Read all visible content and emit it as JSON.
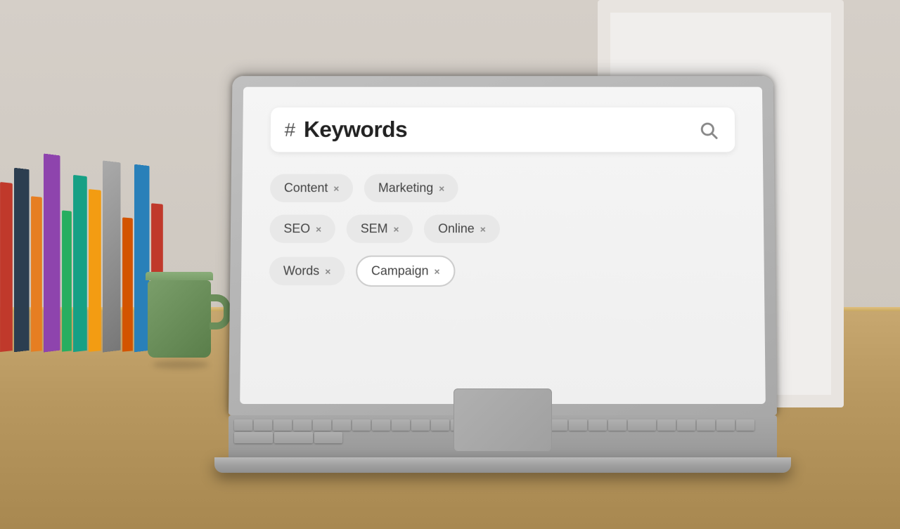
{
  "scene": {
    "background_color": "#c8b8a8"
  },
  "laptop": {
    "screen": {
      "background": "#f0f0f0",
      "search_bar": {
        "hash_symbol": "#",
        "placeholder": "Keywords",
        "search_icon": "🔍"
      },
      "tags": [
        [
          {
            "label": "Content",
            "close": "×"
          },
          {
            "label": "Marketing",
            "close": "×"
          }
        ],
        [
          {
            "label": "SEO",
            "close": "×"
          },
          {
            "label": "SEM",
            "close": "×"
          },
          {
            "label": "Online",
            "close": "×"
          }
        ],
        [
          {
            "label": "Words",
            "close": "×",
            "selected": false
          },
          {
            "label": "Campaign",
            "close": "×",
            "selected": true
          }
        ]
      ]
    }
  },
  "mug": {
    "color": "#7a9e6a"
  },
  "camera": {
    "color": "#666666"
  },
  "cactus": {
    "color": "#4a6840"
  }
}
